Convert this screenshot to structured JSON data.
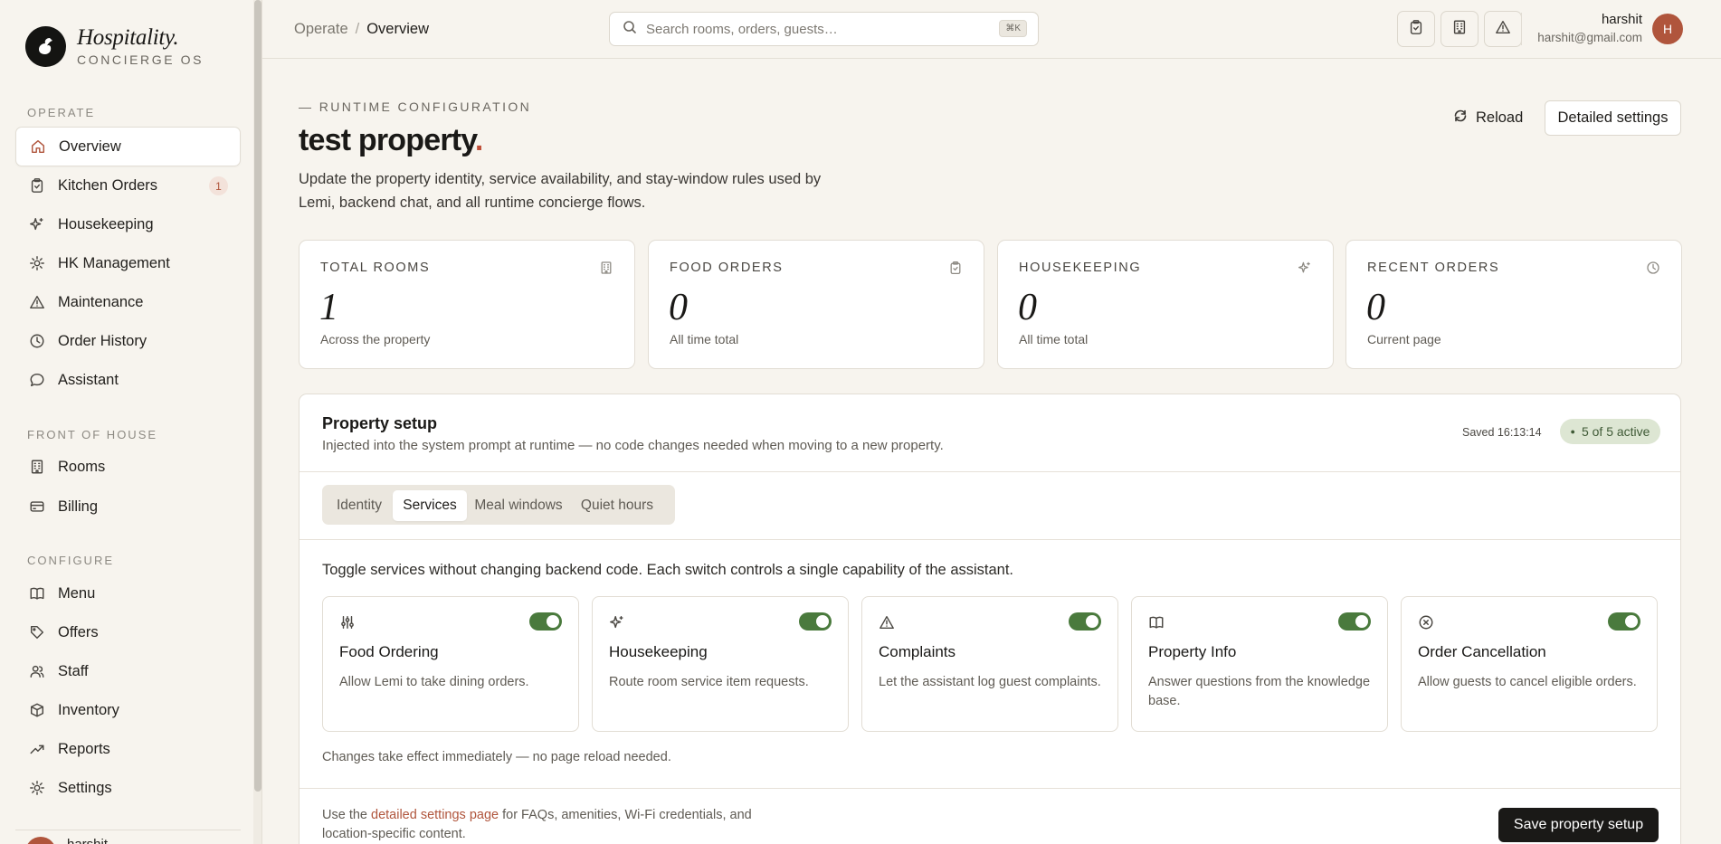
{
  "brand": {
    "name": "Hospitality.",
    "subtitle": "CONCIERGE OS"
  },
  "sidebar": {
    "sections": [
      {
        "label": "OPERATE"
      },
      {
        "label": "FRONT OF HOUSE"
      },
      {
        "label": "CONFIGURE"
      }
    ],
    "items": [
      {
        "label": "Overview",
        "icon": "home-icon",
        "active": true
      },
      {
        "label": "Kitchen Orders",
        "icon": "clipboard-icon",
        "badge": "1"
      },
      {
        "label": "Housekeeping",
        "icon": "sparkle-icon"
      },
      {
        "label": "HK Management",
        "icon": "gear-icon"
      },
      {
        "label": "Maintenance",
        "icon": "warning-icon"
      },
      {
        "label": "Order History",
        "icon": "clock-icon"
      },
      {
        "label": "Assistant",
        "icon": "chat-icon"
      },
      {
        "label": "Rooms",
        "icon": "building-icon"
      },
      {
        "label": "Billing",
        "icon": "card-icon"
      },
      {
        "label": "Menu",
        "icon": "book-icon"
      },
      {
        "label": "Offers",
        "icon": "tag-icon"
      },
      {
        "label": "Staff",
        "icon": "users-icon"
      },
      {
        "label": "Inventory",
        "icon": "box-icon"
      },
      {
        "label": "Reports",
        "icon": "trend-icon"
      },
      {
        "label": "Settings",
        "icon": "gear-icon"
      }
    ],
    "footer_user": "harshit"
  },
  "topbar": {
    "breadcrumb": {
      "parent": "Operate",
      "separator": "/",
      "current": "Overview"
    },
    "search": {
      "placeholder": "Search rooms, orders, guests…",
      "shortcut": "⌘K"
    },
    "user": {
      "name": "harshit",
      "email": "harshit@gmail.com",
      "initial": "H"
    }
  },
  "header": {
    "eyebrow": "— RUNTIME CONFIGURATION",
    "title": "test property",
    "title_dot": ".",
    "description": "Update the property identity, service availability, and stay-window rules used by Lemi, backend chat, and all runtime concierge flows.",
    "reload_label": "Reload",
    "detail_label": "Detailed settings"
  },
  "stats": [
    {
      "label": "TOTAL ROOMS",
      "value": "1",
      "sub": "Across the property",
      "icon": "building-icon"
    },
    {
      "label": "FOOD ORDERS",
      "value": "0",
      "sub": "All time total",
      "icon": "clipboard-icon"
    },
    {
      "label": "HOUSEKEEPING",
      "value": "0",
      "sub": "All time total",
      "icon": "sparkle-icon"
    },
    {
      "label": "RECENT ORDERS",
      "value": "0",
      "sub": "Current page",
      "icon": "clock-icon"
    }
  ],
  "setup": {
    "title": "Property setup",
    "description": "Injected into the system prompt at runtime — no code changes needed when moving to a new property.",
    "saved": "Saved 16:13:14",
    "active_pill": "5 of 5 active",
    "tabs": [
      {
        "label": "Identity"
      },
      {
        "label": "Services",
        "active": true
      },
      {
        "label": "Meal windows"
      },
      {
        "label": "Quiet hours"
      }
    ],
    "intro": "Toggle services without changing backend code. Each switch controls a single capability of the assistant.",
    "services": [
      {
        "title": "Food Ordering",
        "desc": "Allow Lemi to take dining orders.",
        "icon": "sliders-icon",
        "enabled": true
      },
      {
        "title": "Housekeeping",
        "desc": "Route room service item requests.",
        "icon": "sparkle-icon",
        "enabled": true
      },
      {
        "title": "Complaints",
        "desc": "Let the assistant log guest complaints.",
        "icon": "warning-icon",
        "enabled": true
      },
      {
        "title": "Property Info",
        "desc": "Answer questions from the knowledge base.",
        "icon": "book-icon",
        "enabled": true
      },
      {
        "title": "Order Cancellation",
        "desc": "Allow guests to cancel eligible orders.",
        "icon": "cancel-circle-icon",
        "enabled": true
      }
    ],
    "changes_note": "Changes take effect immediately — no page reload needed.",
    "footer_prefix": "Use the ",
    "footer_link": "detailed settings page",
    "footer_suffix": " for FAQs, amenities, Wi-Fi credentials, and location-specific content.",
    "save_label": "Save property setup"
  },
  "colors": {
    "accent": "#b0553c",
    "toggle_on": "#4a7a3d",
    "dark": "#1a1917"
  }
}
